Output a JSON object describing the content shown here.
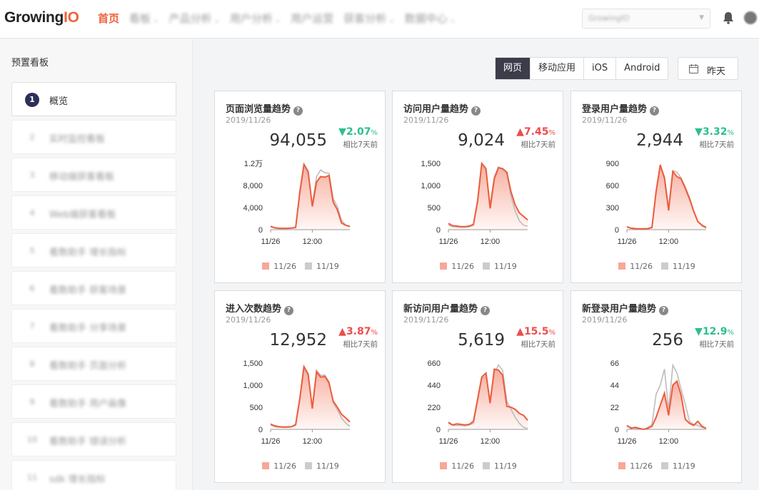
{
  "app": {
    "logo_main": "Growing",
    "logo_accent": "IO",
    "nav": [
      {
        "label": "首页",
        "active": true,
        "caret": false,
        "blurred": false
      },
      {
        "label": "看板",
        "active": false,
        "caret": true,
        "blurred": true
      },
      {
        "label": "产品分析",
        "active": false,
        "caret": true,
        "blurred": true
      },
      {
        "label": "用户分析",
        "active": false,
        "caret": true,
        "blurred": true
      },
      {
        "label": "用户运营",
        "active": false,
        "caret": false,
        "blurred": true
      },
      {
        "label": "获客分析",
        "active": false,
        "caret": true,
        "blurred": true
      },
      {
        "label": "数据中心",
        "active": false,
        "caret": true,
        "blurred": true
      }
    ],
    "project_select": "GrowingIO",
    "colors": {
      "accent": "#f0623c",
      "dark": "#3d3c4b",
      "up": "#ec4d4d",
      "down": "#2ebf8a"
    }
  },
  "sidebar": {
    "title": "预置看板",
    "items": [
      {
        "num": "1",
        "label": "概览"
      },
      {
        "num": "2",
        "label": "实时监控看板"
      },
      {
        "num": "3",
        "label": "移动端获客看板"
      },
      {
        "num": "4",
        "label": "Web端获客看板"
      },
      {
        "num": "5",
        "label": "看数助手 增长指标"
      },
      {
        "num": "6",
        "label": "看数助手 获客场景"
      },
      {
        "num": "7",
        "label": "看数助手 分享场景"
      },
      {
        "num": "8",
        "label": "看数助手 页面分析"
      },
      {
        "num": "9",
        "label": "看数助手 用户画像"
      },
      {
        "num": "10",
        "label": "看数助手 错误分析"
      },
      {
        "num": "11",
        "label": "sdk 增长指标"
      }
    ]
  },
  "toolbar": {
    "platforms": [
      "网页",
      "移动应用",
      "iOS",
      "Android"
    ],
    "active_platform": "网页",
    "date_label": "昨天"
  },
  "cards": [
    {
      "title": "页面浏览量趋势",
      "date": "2019/11/26",
      "value": "94,055",
      "change": "2.07",
      "pct": "%",
      "direction": "down",
      "compare": "相比7天前",
      "chart_data": {
        "type": "area",
        "ymax": 12000,
        "yticks": [
          "0",
          "4,000",
          "8,000",
          "1.2万"
        ],
        "xticks": [
          "11/26",
          "12:00"
        ],
        "series": [
          {
            "name": "11/26",
            "values": [
              600,
              350,
              250,
              250,
              250,
              300,
              400,
              6800,
              11800,
              10500,
              4200,
              8600,
              9600,
              9500,
              9800,
              5000,
              3600,
              1200,
              800,
              600
            ]
          },
          {
            "name": "11/19",
            "values": [
              500,
              300,
              200,
              200,
              200,
              250,
              350,
              6400,
              11300,
              10000,
              4600,
              9600,
              10800,
              10300,
              10200,
              5600,
              4200,
              1700,
              800,
              500
            ]
          }
        ]
      },
      "legend": [
        "11/26",
        "11/19"
      ]
    },
    {
      "title": "访问用户量趋势",
      "date": "2019/11/26",
      "value": "9,024",
      "change": "7.45",
      "pct": "%",
      "direction": "up",
      "compare": "相比7天前",
      "chart_data": {
        "type": "area",
        "ymax": 1500,
        "yticks": [
          "0",
          "500",
          "1,000",
          "1,500"
        ],
        "xticks": [
          "11/26",
          "12:00"
        ],
        "series": [
          {
            "name": "11/26",
            "values": [
              140,
              90,
              80,
              70,
              70,
              80,
              120,
              650,
              1500,
              1380,
              480,
              1150,
              1400,
              1380,
              1300,
              860,
              560,
              380,
              300,
              220
            ]
          },
          {
            "name": "11/19",
            "values": [
              110,
              70,
              60,
              55,
              55,
              65,
              100,
              610,
              1450,
              1320,
              560,
              1200,
              1420,
              1350,
              1250,
              760,
              420,
              200,
              100,
              80
            ]
          }
        ]
      },
      "legend": [
        "11/26",
        "11/19"
      ]
    },
    {
      "title": "登录用户量趋势",
      "date": "2019/11/26",
      "value": "2,944",
      "change": "3.32",
      "pct": "%",
      "direction": "down",
      "compare": "相比7天前",
      "chart_data": {
        "type": "area",
        "ymax": 900,
        "yticks": [
          "0",
          "300",
          "600",
          "900"
        ],
        "xticks": [
          "11/26",
          "12:00"
        ],
        "series": [
          {
            "name": "11/26",
            "values": [
              40,
              20,
              15,
              12,
              12,
              15,
              30,
              520,
              880,
              700,
              260,
              790,
              720,
              690,
              560,
              420,
              250,
              110,
              60,
              30
            ]
          },
          {
            "name": "11/19",
            "values": [
              35,
              18,
              12,
              10,
              10,
              12,
              25,
              500,
              860,
              720,
              300,
              800,
              780,
              700,
              580,
              440,
              260,
              110,
              50,
              20
            ]
          }
        ]
      },
      "legend": [
        "11/26",
        "11/19"
      ]
    },
    {
      "title": "进入次数趋势",
      "date": "2019/11/26",
      "value": "12,952",
      "change": "3.87",
      "pct": "%",
      "direction": "up",
      "compare": "相比7天前",
      "chart_data": {
        "type": "area",
        "ymax": 1500,
        "yticks": [
          "0",
          "500",
          "1,000",
          "1,500"
        ],
        "xticks": [
          "11/26",
          "12:00"
        ],
        "series": [
          {
            "name": "11/26",
            "values": [
              120,
              80,
              60,
              55,
              55,
              60,
              110,
              700,
              1420,
              1250,
              470,
              1300,
              1180,
              1200,
              1050,
              640,
              500,
              340,
              260,
              170
            ]
          },
          {
            "name": "11/19",
            "values": [
              100,
              60,
              50,
              45,
              45,
              55,
              90,
              660,
              1370,
              1200,
              520,
              1340,
              1220,
              1230,
              1080,
              600,
              440,
              260,
              140,
              70
            ]
          }
        ]
      },
      "legend": [
        "11/26",
        "11/19"
      ]
    },
    {
      "title": "新访问用户量趋势",
      "date": "2019/11/26",
      "value": "5,619",
      "change": "15.5",
      "pct": "%",
      "direction": "up",
      "compare": "相比7天前",
      "chart_data": {
        "type": "area",
        "ymax": 660,
        "yticks": [
          "0",
          "220",
          "440",
          "660"
        ],
        "xticks": [
          "11/26",
          "12:00"
        ],
        "series": [
          {
            "name": "11/26",
            "values": [
              70,
              45,
              55,
              50,
              45,
              50,
              80,
              300,
              520,
              560,
              260,
              600,
              590,
              540,
              230,
              220,
              200,
              160,
              140,
              90
            ]
          },
          {
            "name": "11/19",
            "values": [
              60,
              40,
              40,
              40,
              35,
              45,
              60,
              280,
              500,
              520,
              300,
              560,
              640,
              590,
              280,
              200,
              120,
              60,
              20,
              10
            ]
          }
        ]
      },
      "legend": [
        "11/26",
        "11/19"
      ]
    },
    {
      "title": "新登录用户量趋势",
      "date": "2019/11/26",
      "value": "256",
      "change": "12.9",
      "pct": "%",
      "direction": "down",
      "compare": "相比7天前",
      "chart_data": {
        "type": "area",
        "ymax": 66,
        "yticks": [
          "0",
          "22",
          "44",
          "66"
        ],
        "xticks": [
          "11/26",
          "12:00"
        ],
        "series": [
          {
            "name": "11/26",
            "values": [
              4,
              1,
              2,
              1,
              0,
              1,
              3,
              12,
              24,
              36,
              14,
              44,
              48,
              34,
              10,
              6,
              4,
              8,
              3,
              1
            ]
          },
          {
            "name": "11/19",
            "values": [
              3,
              2,
              1,
              1,
              0,
              2,
              5,
              35,
              44,
              60,
              20,
              64,
              56,
              40,
              25,
              8,
              5,
              4,
              2,
              1
            ]
          }
        ]
      },
      "legend": [
        "11/26",
        "11/19"
      ]
    }
  ]
}
